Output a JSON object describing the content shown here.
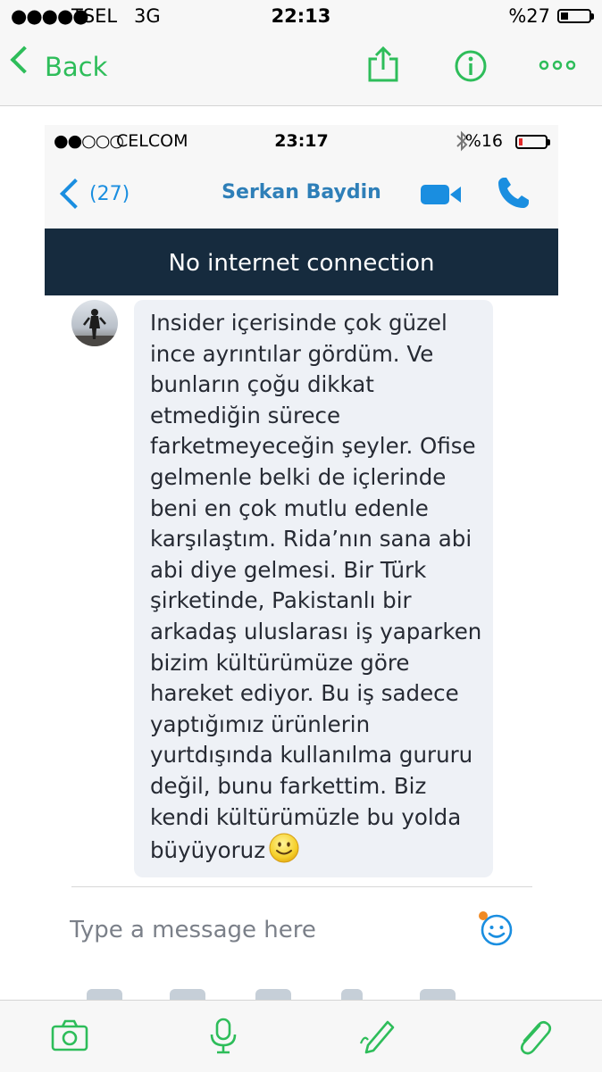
{
  "outer_status": {
    "signal": "●●●●●",
    "carrier": "TSEL",
    "network": "3G",
    "time": "22:13",
    "battery_percent": "%27",
    "battery_level": 0.27
  },
  "outer_nav": {
    "back_label": "Back",
    "icons": [
      "share-icon",
      "info-icon",
      "more-icon"
    ]
  },
  "inner_status": {
    "signal": "●●○○○",
    "carrier": "CELCOM",
    "time": "23:17",
    "battery_percent": "%16",
    "battery_level": 0.16
  },
  "inner_nav": {
    "back_count": "(27)",
    "contact_name": "Serkan Baydin",
    "icons": [
      "video-call-icon",
      "phone-call-icon"
    ]
  },
  "banner": {
    "text": "No internet connection"
  },
  "message": {
    "text": "Insider içerisinde çok güzel ince ayrıntılar gördüm. Ve bunların çoğu dikkat etmediğin sürece farketmeyeceğin şeyler. Ofise gelmenle belki de içlerinde beni en çok mutlu edenle karşılaştım. Rida’nın sana abi abi diye gelmesi. Bir Türk şirketinde, Pakistanlı bir arkadaş uluslarası iş yaparken bizim kültürümüze göre hareket ediyor. Bu iş sadece yaptığımız ürünlerin yurtdışında kullanılma gururu değil, bunu farkettim. Biz kendi kültürümüzle bu yolda büyüyoruz",
    "emoji": "smiley-emoji"
  },
  "composer": {
    "placeholder": "Type a message here"
  },
  "toolbar": {
    "icons": [
      "camera-icon",
      "microphone-icon",
      "pen-icon",
      "paperclip-icon"
    ]
  },
  "colors": {
    "accent_green": "#2ebd5a",
    "skype_blue": "#1a8ee0",
    "banner_bg": "#162b3e",
    "bubble_bg": "#eef1f6"
  }
}
